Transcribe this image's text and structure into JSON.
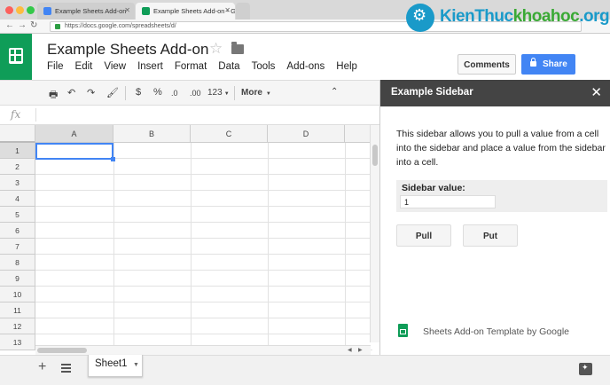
{
  "browser": {
    "tabs": [
      {
        "label": "Example Sheets Add-on",
        "favicon_color": "#4285f4"
      },
      {
        "label": "Example Sheets Add-on - Goo",
        "favicon_color": "#0f9d58"
      }
    ],
    "url": "https://docs.google.com/spreadsheets/d/"
  },
  "doc": {
    "title": "Example Sheets Add-on",
    "menu": [
      "File",
      "Edit",
      "View",
      "Insert",
      "Format",
      "Data",
      "Tools",
      "Add-ons",
      "Help"
    ],
    "comments_label": "Comments",
    "share_label": "Share"
  },
  "toolbar": {
    "currency": "$",
    "percent": "%",
    "dec_decrease": ".0",
    "dec_increase": ".00",
    "format_more": "123",
    "more_label": "More"
  },
  "formula": {
    "fx": "fx"
  },
  "grid": {
    "columns": [
      "A",
      "B",
      "C",
      "D"
    ],
    "rows": [
      "1",
      "2",
      "3",
      "4",
      "5",
      "6",
      "7",
      "8",
      "9",
      "10",
      "11",
      "12",
      "13"
    ]
  },
  "sheets": {
    "active": "Sheet1"
  },
  "sidebar": {
    "title": "Example Sidebar",
    "description": "This sidebar allows you to pull a value from a cell into the sidebar and place a value from the sidebar into a cell.",
    "field_label": "Sidebar value:",
    "field_value": "1",
    "pull_label": "Pull",
    "put_label": "Put",
    "footer": "Sheets Add-on Template by Google"
  },
  "watermark": {
    "part1": "Kien",
    "part2": "Thuc",
    "part3": "khoahoc",
    "part4": ".org"
  },
  "colors": {
    "sheets_green": "#0f9d58",
    "share_blue": "#4285f4",
    "sidebar_header": "#444444",
    "watermark_blue": "#1a9ac9",
    "watermark_green": "#3aa935"
  }
}
